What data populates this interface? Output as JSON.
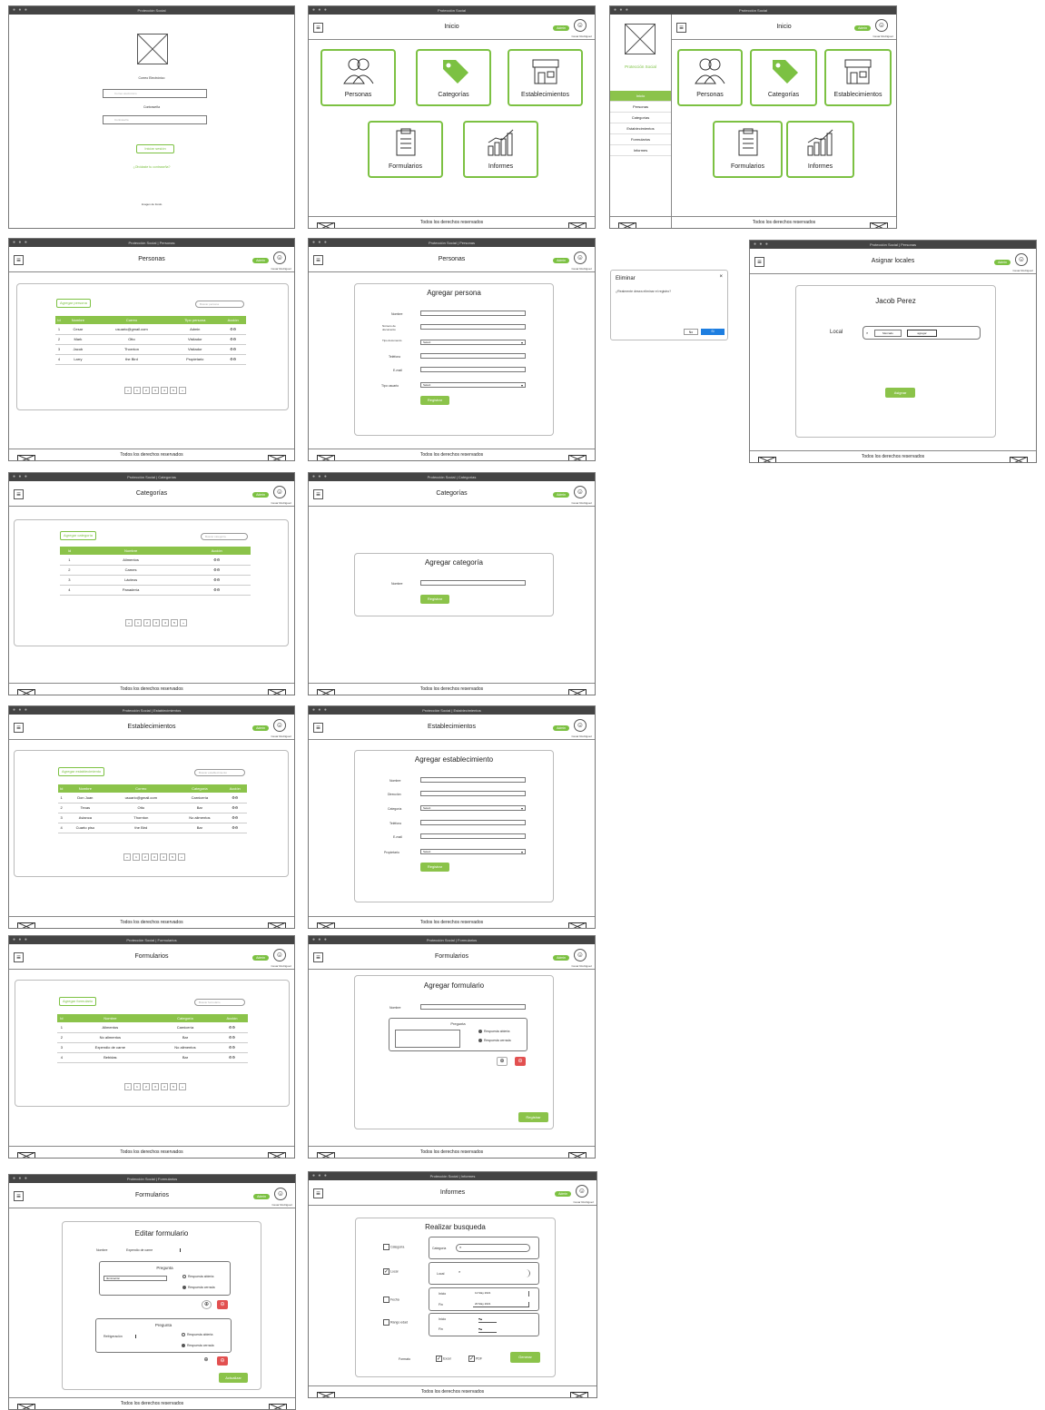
{
  "app": {
    "title": "Protección Social",
    "inicio": "Inicio",
    "admin_badge": "Admin",
    "user": "Cesar Rodriguez",
    "footer": "Todos los derechos reservados"
  },
  "login": {
    "window_title": "Protección Social",
    "email_label": "Correo Electrónico",
    "email_placeholder": "Correo electrónico",
    "password_label": "Contraseña",
    "password_placeholder": "Contraseña",
    "login_button": "Iniciar sesión",
    "forgot": "¿Olvidaste tu contraseña?",
    "footer_note": "Imagen de fondo"
  },
  "tiles": [
    "Personas",
    "Categorías",
    "Establecimientos",
    "Formularios",
    "Informes"
  ],
  "sidebar": {
    "logo_text": "Protección Social",
    "items": [
      "Inicio",
      "Personas",
      "Categorías",
      "Establecimientos",
      "Formularios",
      "Informes"
    ]
  },
  "personas": {
    "window_title": "Protección Social | Personas",
    "title": "Personas",
    "add_button": "Agregar persona",
    "search": "Buscar persona",
    "columns": [
      "Id",
      "Nombre",
      "Correo",
      "Tipo persona",
      "Acción"
    ],
    "rows": [
      [
        "1",
        "Cesar",
        "usuario@gmail.com",
        "Admin",
        "⚙⚙"
      ],
      [
        "2",
        "Mark",
        "Otto",
        "Visitador",
        "⚙⚙"
      ],
      [
        "3",
        "Jacob",
        "Thornton",
        "Visitador",
        "⚙⚙"
      ],
      [
        "4",
        "Larry",
        "the Bird",
        "Propietario",
        "⚙⚙"
      ]
    ],
    "pages": [
      "«",
      "1",
      "2",
      "3",
      "4",
      "5",
      "»"
    ]
  },
  "agregar_persona": {
    "window_title": "Protección Social | Personas",
    "title": "Agregar persona",
    "fields": [
      "Nombre",
      "Número de documento",
      "Tipo documento",
      "Teléfono",
      "E-mail",
      "Tipo usuario"
    ],
    "select_default": "Select",
    "submit": "Registrar"
  },
  "eliminar": {
    "title": "Eliminar",
    "message": "¿Realmente desea eliminar el registro?",
    "no": "No",
    "si": "Sí"
  },
  "asignar": {
    "window_title": "Protección Social | Personas",
    "title": "Asignar locales",
    "person": "Jacob Perez",
    "local_label": "Local",
    "chip1": "Mercado",
    "chip2": "agregar",
    "submit": "Asignar"
  },
  "categorias": {
    "window_title": "Protección Social | Categorías",
    "title": "Categorías",
    "add_button": "Agregar categoría",
    "search": "Buscar categoría",
    "columns": [
      "Id",
      "Nombre",
      "Acción"
    ],
    "rows": [
      [
        "1",
        "Alimentos",
        "⚙⚙"
      ],
      [
        "2",
        "Carnes",
        "⚙⚙"
      ],
      [
        "3",
        "Lácteos",
        "⚙⚙"
      ],
      [
        "4",
        "Panadería",
        "⚙⚙"
      ]
    ],
    "pages": [
      "«",
      "1",
      "2",
      "3",
      "4",
      "5",
      "»"
    ]
  },
  "agregar_categoria": {
    "window_title": "Protección Social | Categorías",
    "title": "Agregar categoría",
    "name_label": "Nombre",
    "submit": "Registrar"
  },
  "establecimientos": {
    "window_title": "Protección Social | Establecimientos",
    "title": "Establecimientos",
    "add_button": "Agregar establecimiento",
    "search": "Buscar establecimiento",
    "columns": [
      "Id",
      "Nombre",
      "Correo",
      "Categoría",
      "Acción"
    ],
    "rows": [
      [
        "1",
        "Don Juan",
        "usuario@gmail.com",
        "Carnicería",
        "⚙⚙"
      ],
      [
        "2",
        "Texas",
        "Otto",
        "Bar",
        "⚙⚙"
      ],
      [
        "3",
        "Avianca",
        "Thornton",
        "No alimentos",
        "⚙⚙"
      ],
      [
        "4",
        "Cuarto piso",
        "the Bird",
        "Bar",
        "⚙⚙"
      ]
    ],
    "pages": [
      "«",
      "1",
      "2",
      "3",
      "4",
      "5",
      "»"
    ]
  },
  "agregar_establecimiento": {
    "window_title": "Protección Social | Establecimientos",
    "title": "Agregar establecimiento",
    "fields": [
      "Nombre",
      "Dirección",
      "Categoría",
      "Teléfono",
      "E-mail",
      "Propietario"
    ],
    "select_default": "Select",
    "submit": "Registrar"
  },
  "formularios": {
    "window_title": "Protección Social | Formularios",
    "title": "Formularios",
    "add_button": "Agregar formulario",
    "search": "Buscar formulario",
    "columns": [
      "Id",
      "Nombre",
      "Categoría",
      "Acción"
    ],
    "rows": [
      [
        "1",
        "Alimentos",
        "Carnicería",
        "⚙⚙"
      ],
      [
        "2",
        "No alimentos",
        "Bar",
        "⚙⚙"
      ],
      [
        "3",
        "Expendio de carne",
        "No alimentos",
        "⚙⚙"
      ],
      [
        "4",
        "Bebidas",
        "Bar",
        "⚙⚙"
      ]
    ],
    "pages": [
      "«",
      "1",
      "2",
      "3",
      "4",
      "5",
      "»"
    ]
  },
  "agregar_formulario": {
    "window_title": "Protección Social | Formularios",
    "title": "Agregar formulario",
    "name_label": "Nombre",
    "question_label": "Pregunta",
    "opt1": "Respuesta abierta",
    "opt2": "Respuesta cerrada",
    "submit": "Registrar"
  },
  "editar_formulario": {
    "window_title": "Protección Social | Formularios",
    "title": "Editar formulario",
    "name_label": "Nombre",
    "name_value": "Expendio de carne",
    "q_label": "Pregunta",
    "q1_value": "Iluminación",
    "q2_value": "Refrigeración",
    "opt1": "Respuesta abierta",
    "opt2": "Respuesta cerrada",
    "submit": "Actualizar"
  },
  "informes": {
    "window_title": "Protección Social | Informes",
    "title": "Informes",
    "card_title": "Realizar busqueda",
    "filters": [
      "Categoría",
      "Local",
      "Fecha",
      "Rango edad"
    ],
    "categoria_label": "Categoría",
    "local_label": "Local",
    "inicio": "Inicio",
    "fin": "Fin",
    "date1": "12 May 2021",
    "date2": "20 May 2021",
    "formato": "Formato",
    "excel": "Excel",
    "pdf": "PDF",
    "submit": "Generar"
  }
}
